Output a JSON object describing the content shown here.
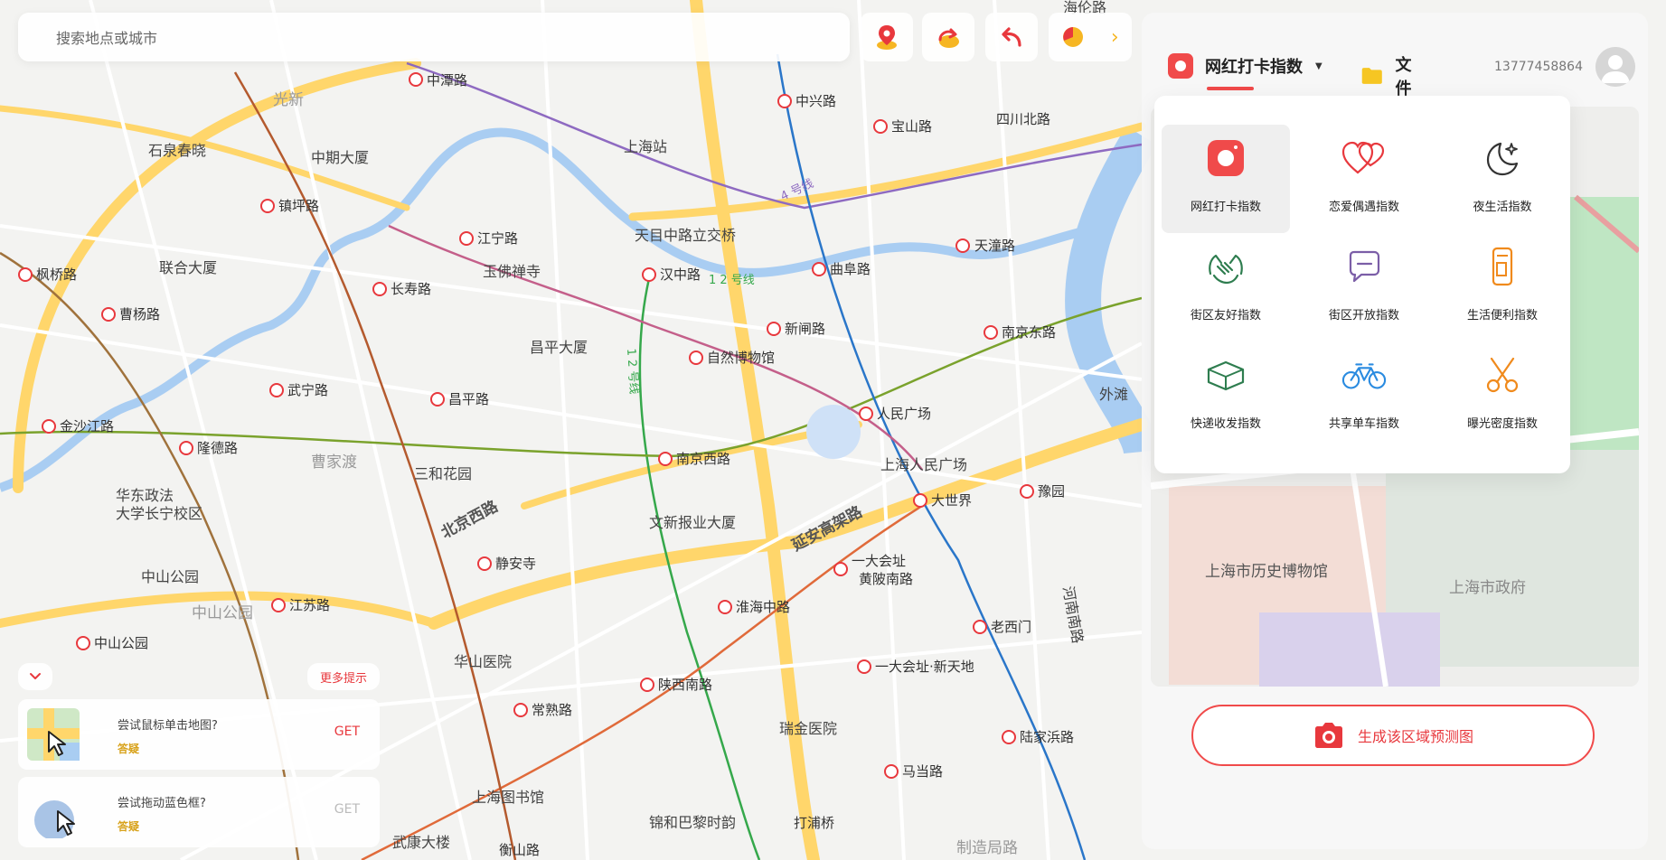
{
  "search": {
    "placeholder": "搜索地点或城市"
  },
  "toolbar": {
    "buttons": [
      {
        "name": "location",
        "icon": "location-pin-icon"
      },
      {
        "name": "redo",
        "icon": "redo-arrow-icon"
      },
      {
        "name": "undo",
        "icon": "undo-arrow-icon"
      }
    ],
    "extra": {
      "icon": "pie-chart-icon",
      "chevron": "›"
    }
  },
  "header": {
    "active_tab": "网红打卡指数",
    "file_tab": "文件",
    "phone": "13777458864"
  },
  "index_menu": {
    "items": [
      {
        "label": "网红打卡指数",
        "icon": "camera-icon",
        "color": "#f04a4a",
        "selected": true
      },
      {
        "label": "恋爱偶遇指数",
        "icon": "hearts-icon",
        "color": "#e8383d"
      },
      {
        "label": "夜生活指数",
        "icon": "moon-icon",
        "color": "#333333"
      },
      {
        "label": "街区友好指数",
        "icon": "handshake-icon",
        "color": "#2e7d4f"
      },
      {
        "label": "街区开放指数",
        "icon": "chat-bubble-icon",
        "color": "#7b5ea7"
      },
      {
        "label": "生活便利指数",
        "icon": "cup-icon",
        "color": "#f08a1c"
      },
      {
        "label": "快递收发指数",
        "icon": "parcel-icon",
        "color": "#2e7d4f"
      },
      {
        "label": "共享单车指数",
        "icon": "bicycle-icon",
        "color": "#2a8be0"
      },
      {
        "label": "曝光密度指数",
        "icon": "scissors-icon",
        "color": "#f08a1c"
      }
    ]
  },
  "generate": {
    "label": "生成该区域预测图"
  },
  "hints": {
    "more_label": "更多提示",
    "cards": [
      {
        "question": "尝试鼠标单击地图?",
        "answer": "答疑",
        "get": "GET",
        "enabled": true
      },
      {
        "question": "尝试拖动蓝色框?",
        "answer": "答疑",
        "get": "GET",
        "enabled": false
      }
    ]
  },
  "map": {
    "labels": {
      "zhongtan": "中潭路",
      "shanghai_station": "上海站",
      "zhongxing": "中兴路",
      "baoshan": "宝山路",
      "sichuan_n": "四川北路",
      "tiantong": "天潼路",
      "shimen": "石泉春晓",
      "zhongqi": "中期大厦",
      "zhenping": "镇坪路",
      "jiangning": "江宁路",
      "tianmu": "天目中路立交桥",
      "hanzhong": "汉中路",
      "qufu": "曲阜路",
      "yufo": "玉佛禅寺",
      "changshou": "长寿路",
      "caoyang": "曹杨路",
      "fengqiao": "枫桥路",
      "lianhe": "联合大厦",
      "xinzha": "新闸路",
      "nanjing_e": "南京东路",
      "changping_dasha": "昌平大厦",
      "ziran": "自然博物馆",
      "wuning": "武宁路",
      "changping": "昌平路",
      "renmin": "人民广场",
      "waitan": "外滩",
      "jinshajiang": "金沙江路",
      "longde": "隆德路",
      "caojiadu": "曹家渡",
      "sanhe": "三和花园",
      "nanjing_w": "南京西路",
      "renmin_park": "上海人民广场",
      "dashijie": "大世界",
      "yuyuan": "豫园",
      "huadong": "华东政法",
      "huadong2": "大学长宁校区",
      "beijing_w": "北京西路",
      "wenxin": "文新报业大厦",
      "yanan": "延安高架路",
      "jingan": "静安寺",
      "yidahuizhi": "一大会址",
      "huangpi": "黄陂南路",
      "zhongshan_park": "中山公园",
      "zhongshan_park2": "中山公园",
      "jiangsu": "江苏路",
      "zhongshan_road": "中山公园",
      "huaihai": "淮海中路",
      "laoximen": "老西门",
      "henan": "河南南路",
      "huashan": "华山医院",
      "xintiandi": "一大会址·新天地",
      "changshu": "常熟路",
      "shaanxi": "陕西南路",
      "ruijin": "瑞金医院",
      "lujiabang": "陆家浜路",
      "madang": "马当路",
      "library": "上海图书馆",
      "jinjiang": "锦和巴黎时韵",
      "dapuqiao": "打浦桥",
      "wukang": "武康大楼",
      "hengshan": "衡山路",
      "zhizaoju": "制造局路",
      "guangxin": "光新",
      "beimen": "海伦路",
      "line12": "1 2 号线",
      "line12v": "1 2 号线",
      "line4": "4 号线"
    }
  },
  "preview": {
    "history_museum": "上海市历史博物馆",
    "gov": "上海市政府"
  }
}
